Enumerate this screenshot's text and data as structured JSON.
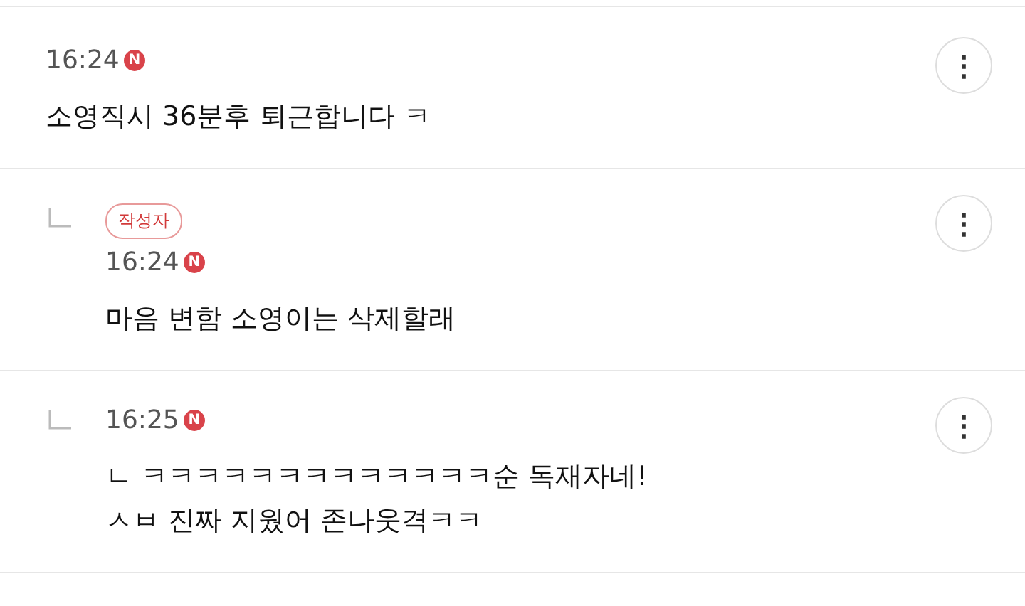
{
  "comments": [
    {
      "kind": "comment",
      "time": "16:24",
      "new_badge": "N",
      "lines": [
        "소영직시 36분후 퇴근합니다 ㅋ"
      ],
      "menu": "⋮"
    },
    {
      "kind": "reply",
      "author_badge": "작성자",
      "time": "16:24",
      "new_badge": "N",
      "lines": [
        "마음 변함 소영이는 삭제할래"
      ],
      "menu": "⋮"
    },
    {
      "kind": "reply",
      "time": "16:25",
      "new_badge": "N",
      "lines": [
        "ㄴ ㅋㅋㅋㅋㅋㅋㅋㅋㅋㅋㅋㅋㅋ순 독재자네!",
        "ㅅㅂ 진짜 지웠어 존나웃격ㅋㅋ"
      ],
      "menu": "⋮"
    }
  ]
}
